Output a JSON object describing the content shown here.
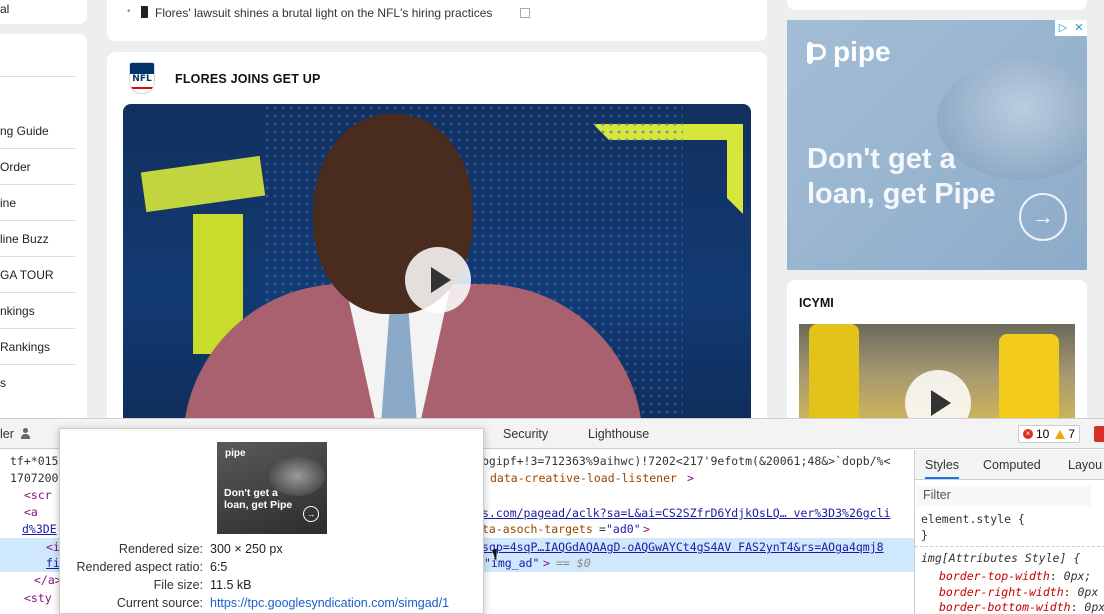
{
  "left_sidebar": {
    "top_text": "al",
    "items": [
      "ng Guide",
      "Order",
      "ine",
      "line Buzz",
      "GA TOUR",
      "nkings",
      "Rankings",
      "s"
    ]
  },
  "article": {
    "bullet": "•",
    "headline": "Flores' lawsuit shines a brutal light on the NFL's hiring practices",
    "logo_text": "NFL",
    "video_title": "FLORES JOINS GET UP"
  },
  "ad": {
    "brand": "pipe",
    "headline": "Don't get a loan, get Pipe",
    "arrow": "→",
    "adchoice_play": "▷",
    "adchoice_close": "✕"
  },
  "icymi": {
    "title": "ICYMI"
  },
  "devtools": {
    "tabs": {
      "left_partial": "ler",
      "security": "Security",
      "lighthouse": "Lighthouse"
    },
    "errors_count": "10",
    "warnings_count": "7",
    "code": {
      "line1_left": "tf+*015",
      "line2_left": "1707200",
      "line3_left": "<scr",
      "line4_left": "<a",
      "line5_left": "d%3DE",
      "line6_left": "<i",
      "line7_left": "fi",
      "line8_left": "</a>",
      "line9_left": "<sty",
      "line1_right": "bgipf+!3=712363%9aihwc)!7202<217'9efotm(&20061;48&>`dopb/%<",
      "line2_attr": "data-creative-load-listener",
      "line2_close": ">",
      "line3_link": "s.com/pagead/aclk?sa=L&ai=CS2SZfrD6YdjkOsLQ… ver%3D3%26gcli",
      "line4_attr": "ta-asoch-targets",
      "line4_val": "\"ad0\"",
      "line4_close": ">",
      "line5_link": "sqp=4sqP…IAQGdAQAAgD-oAQGwAYCt4gS4AV FAS2ynT4&rs=AOga4qmj8",
      "line6_val": "\"img_ad\"",
      "line6_close": ">",
      "line6_eq": "== $0"
    },
    "styles_pane": {
      "tab_styles": "Styles",
      "tab_computed": "Computed",
      "tab_layout": "Layou",
      "filter_placeholder": "Filter",
      "rule1_selector": "element.style {",
      "rule1_close": "}",
      "rule2_selector": "img[Attributes Style] {",
      "props": [
        {
          "name": "border-top-width",
          "value": "0px;"
        },
        {
          "name": "border-right-width",
          "value": "0px"
        },
        {
          "name": "border-bottom-width",
          "value": "0px"
        }
      ]
    }
  },
  "tooltip": {
    "thumb_brand": "pipe",
    "thumb_headline": "Don't get a loan, get Pipe",
    "thumb_arrow": "→",
    "rows": [
      {
        "key": "Rendered size:",
        "value": "300 × 250 px"
      },
      {
        "key": "Rendered aspect ratio:",
        "value": "6:5"
      },
      {
        "key": "File size:",
        "value": "11.5 kB"
      },
      {
        "key": "Current source:",
        "value": "https://tpc.googlesyndication.com/simgad/1"
      }
    ]
  }
}
